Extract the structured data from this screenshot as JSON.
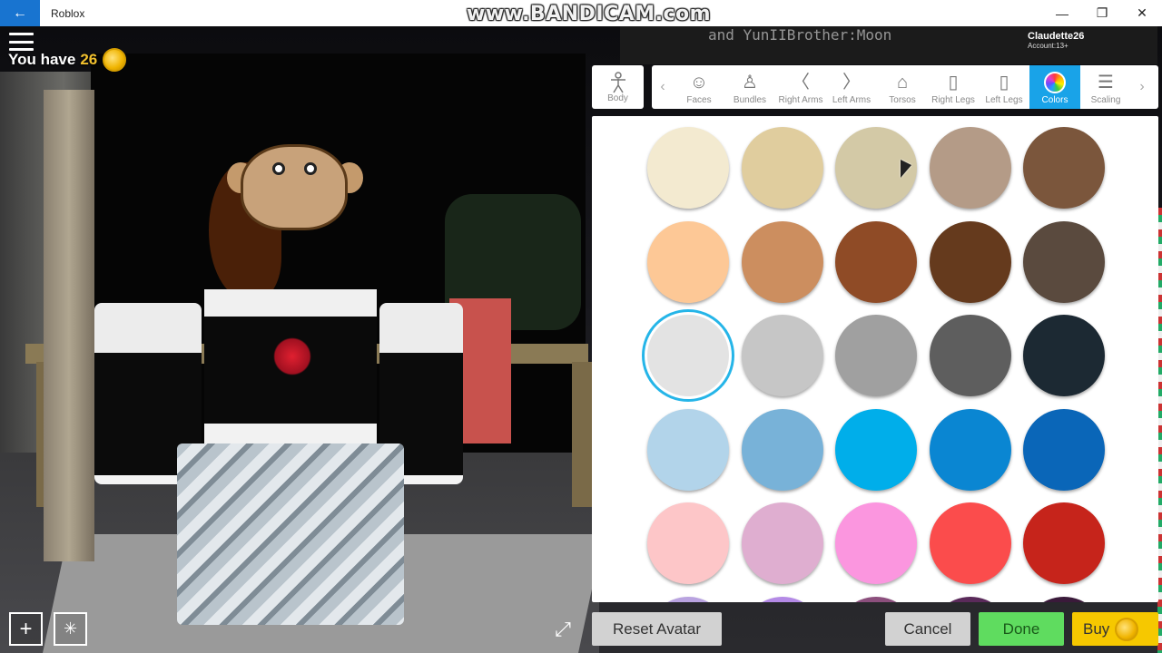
{
  "window": {
    "title": "Roblox",
    "back_glyph": "←",
    "watermark": "www.BANDICAM.com",
    "controls": {
      "minimize": "—",
      "restore": "❐",
      "close": "✕"
    }
  },
  "scene": {
    "sign_text": "and YunIIBrother:Moon"
  },
  "user": {
    "name": "Claudette26",
    "account": "Account:13+"
  },
  "hud": {
    "you_have": "You have",
    "coins": "26"
  },
  "editor": {
    "body_tab": {
      "label": "Body",
      "icon": "body-icon"
    },
    "categories": [
      {
        "label": "Faces",
        "icon": "face-icon",
        "glyph": "☺"
      },
      {
        "label": "Bundles",
        "icon": "bundle-icon",
        "glyph": "♙"
      },
      {
        "label": "Right Arms",
        "icon": "right-arm-icon",
        "glyph": "〈"
      },
      {
        "label": "Left Arms",
        "icon": "left-arm-icon",
        "glyph": "〉"
      },
      {
        "label": "Torsos",
        "icon": "torso-icon",
        "glyph": "⌂"
      },
      {
        "label": "Right Legs",
        "icon": "right-leg-icon",
        "glyph": "▯"
      },
      {
        "label": "Left Legs",
        "icon": "left-leg-icon",
        "glyph": "▯"
      },
      {
        "label": "Colors",
        "icon": "color-wheel-icon",
        "glyph": "",
        "active": true
      },
      {
        "label": "Scaling",
        "icon": "sliders-icon",
        "glyph": "☰"
      }
    ],
    "colors": [
      [
        "#f3ead0",
        "#e0cd9e",
        "#d3c9a6",
        "#b49b87",
        "#7b563c"
      ],
      [
        "#fdc896",
        "#cc8e5f",
        "#8f4b26",
        "#653a1d",
        "#5a4a3e"
      ],
      [
        "#e3e3e3",
        "#c6c6c6",
        "#a0a0a0",
        "#5e5e5e",
        "#1c2933"
      ],
      [
        "#b2d4ea",
        "#78b2d8",
        "#00aeea",
        "#0a86d2",
        "#0a66b8"
      ],
      [
        "#fdc6c8",
        "#dfaed0",
        "#fb96df",
        "#fb4c4c",
        "#c6241b"
      ]
    ],
    "selected": {
      "row": 2,
      "col": 0
    }
  },
  "buttons": {
    "reset": "Reset Avatar",
    "cancel": "Cancel",
    "done": "Done",
    "buy": "Buy"
  }
}
